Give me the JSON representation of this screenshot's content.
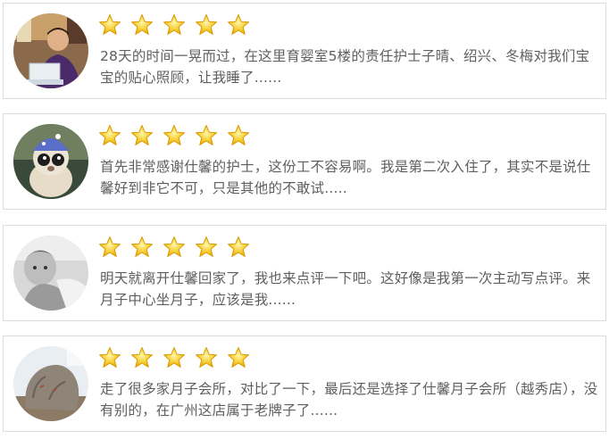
{
  "reviews": [
    {
      "avatar": "user-photo-man-laptop",
      "rating": 5,
      "text": "28天的时间一晃而过，在这里育婴室5楼的责任护士子晴、绍兴、冬梅对我们宝宝的贴心照顾，让我睡了......"
    },
    {
      "avatar": "user-photo-plush-toy",
      "rating": 5,
      "text": "首先非常感谢仕馨的护士，这份工不容易啊。我是第二次入住了，其实不是说仕馨好到非它不可，只是其他的不敢试....."
    },
    {
      "avatar": "user-photo-child-grayscale",
      "rating": 5,
      "text": "明天就离开仕馨回家了，我也来点评一下吧。这好像是我第一次主动写点评。来月子中心坐月子，应该是我......"
    },
    {
      "avatar": "user-photo-rock",
      "rating": 5,
      "text": "走了很多家月子会所，对比了一下，最后还是选择了仕馨月子会所（越秀店），没有别的，在广州这店属于老牌子了......"
    }
  ],
  "colors": {
    "star_fill": "#f6c21c",
    "star_stroke": "#d99a06",
    "text": "#5f5f5f",
    "card_border": "#dcdcdc"
  }
}
